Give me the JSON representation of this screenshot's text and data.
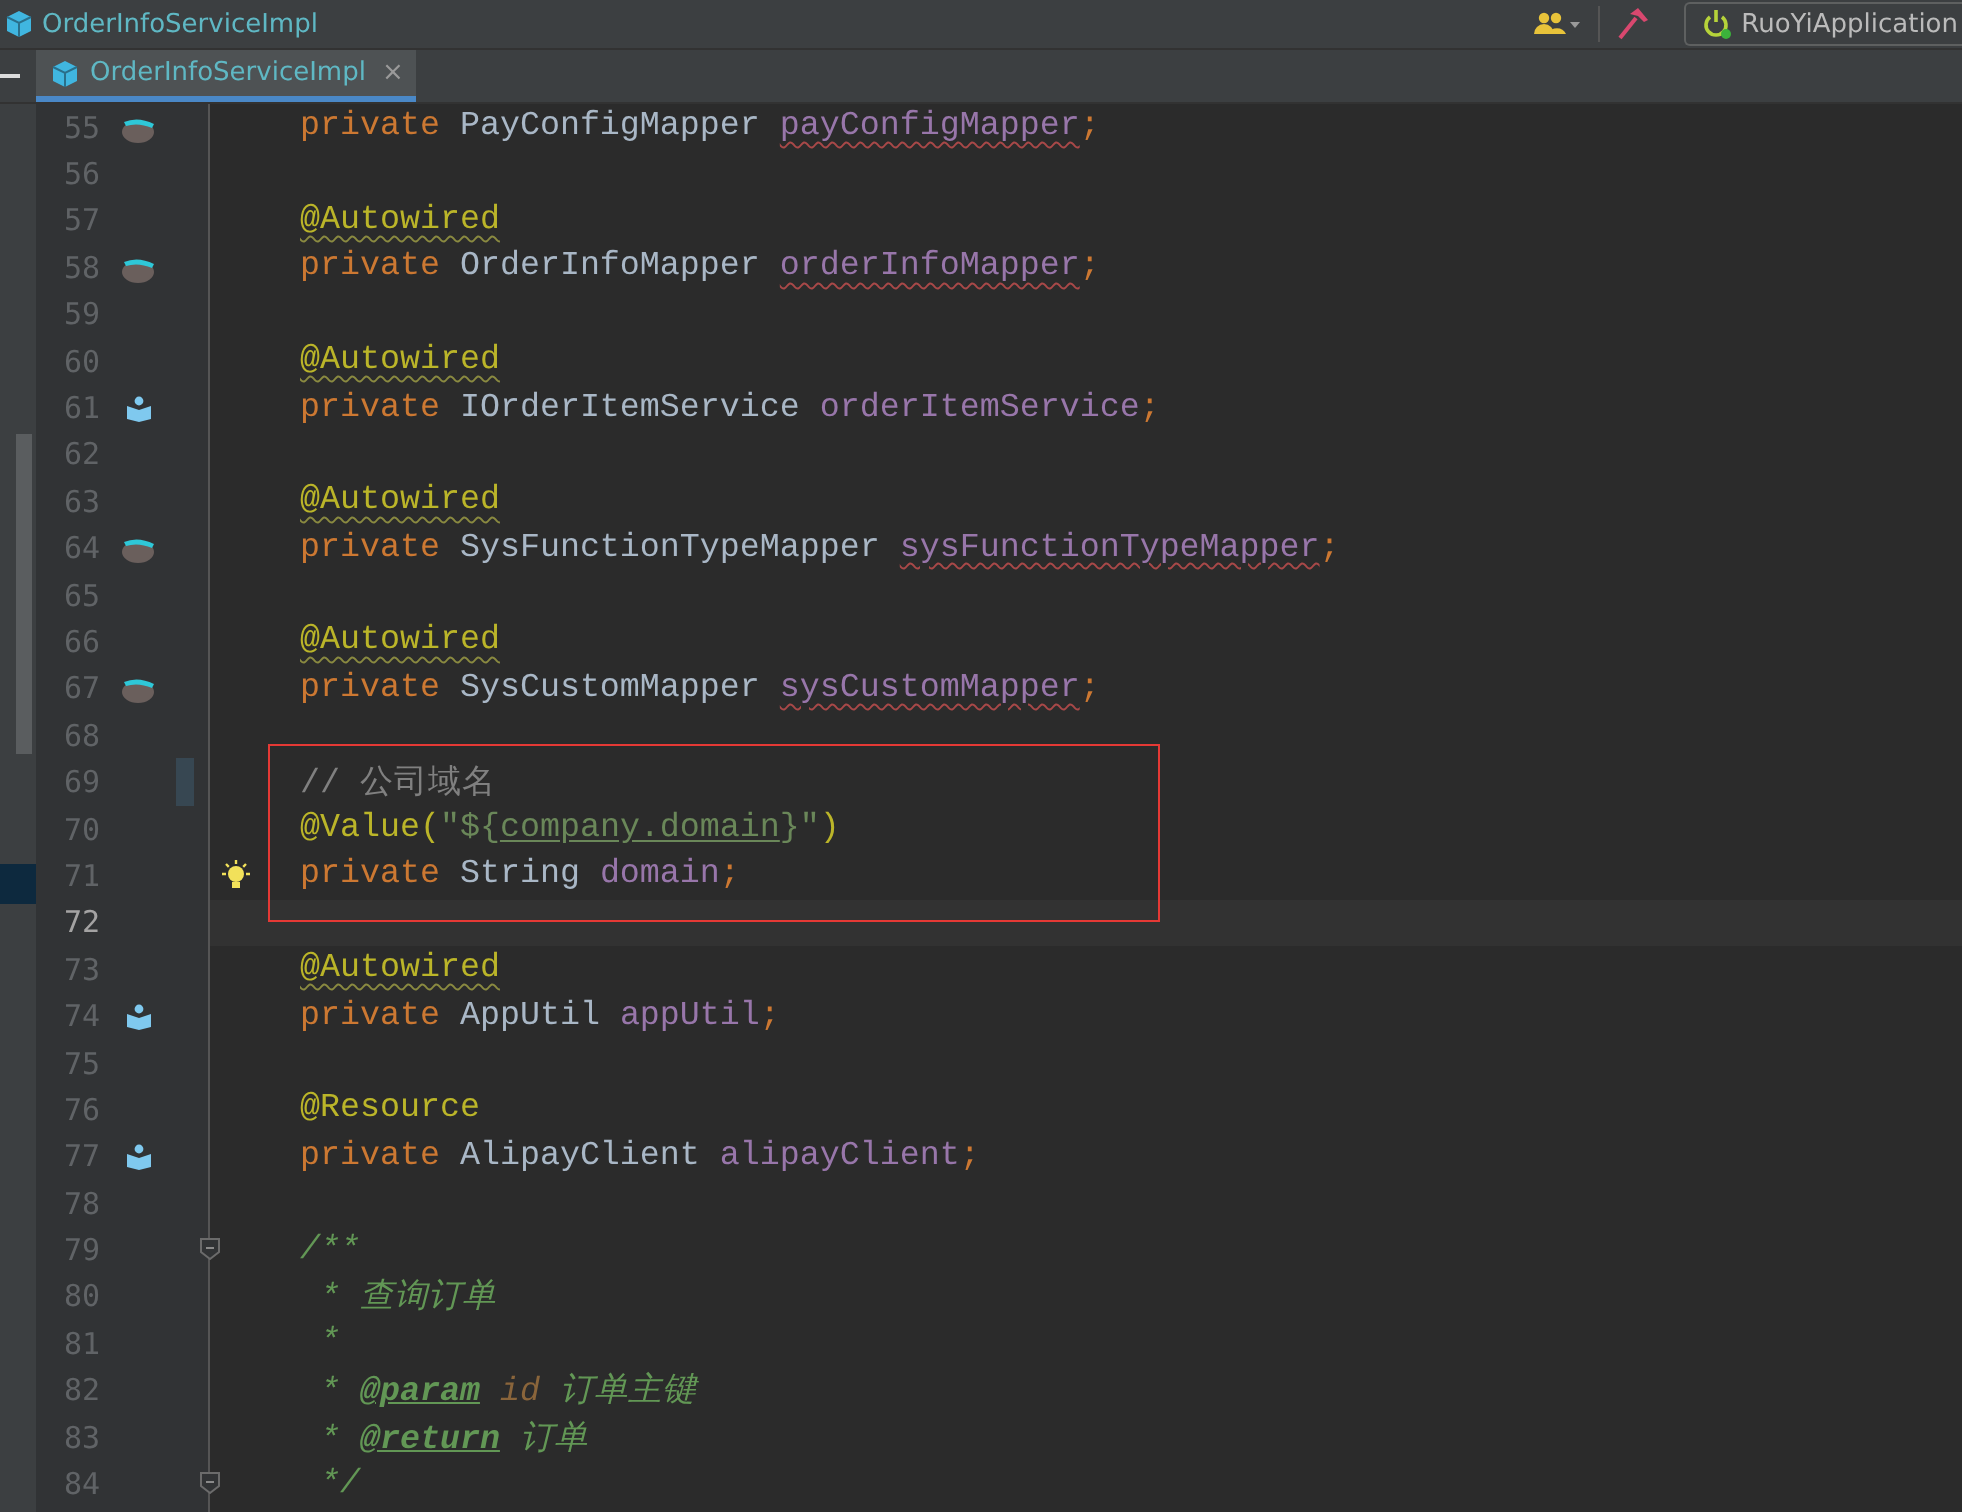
{
  "title_bar": {
    "file_name": "OrderInfoServiceImpl",
    "run_config": "RuoYiApplication"
  },
  "tabs": [
    {
      "label": "OrderInfoServiceImpl",
      "selected": true,
      "close": "×"
    }
  ],
  "editor": {
    "lines": [
      {
        "number": "55",
        "gutter_icon": {
          "kind": "bean"
        },
        "tokens": [
          {
            "text": "private ",
            "kind": "keyword"
          },
          {
            "text": "PayConfigMapper ",
            "kind": "type"
          },
          {
            "text": "payConfigMapper",
            "kind": "field",
            "typo": true
          },
          {
            "text": ";",
            "kind": "keyword"
          }
        ]
      },
      {
        "number": "56"
      },
      {
        "number": "57",
        "tokens": [
          {
            "text": "@Autowired",
            "kind": "annotation",
            "warning": true
          }
        ]
      },
      {
        "number": "58",
        "gutter_icon": {
          "kind": "bean"
        },
        "tokens": [
          {
            "text": "private ",
            "kind": "keyword"
          },
          {
            "text": "OrderInfoMapper ",
            "kind": "type"
          },
          {
            "text": "orderInfoMapper",
            "kind": "field",
            "typo": true
          },
          {
            "text": ";",
            "kind": "keyword"
          }
        ]
      },
      {
        "number": "59"
      },
      {
        "number": "60",
        "tokens": [
          {
            "text": "@Autowired",
            "kind": "annotation",
            "warning": true
          }
        ]
      },
      {
        "number": "61",
        "gutter_icon": {
          "kind": "implement"
        },
        "tokens": [
          {
            "text": "private ",
            "kind": "keyword"
          },
          {
            "text": "IOrderItemService ",
            "kind": "type"
          },
          {
            "text": "orderItemService",
            "kind": "field"
          },
          {
            "text": ";",
            "kind": "keyword"
          }
        ]
      },
      {
        "number": "62"
      },
      {
        "number": "63",
        "tokens": [
          {
            "text": "@Autowired",
            "kind": "annotation",
            "warning": true
          }
        ]
      },
      {
        "number": "64",
        "gutter_icon": {
          "kind": "bean"
        },
        "tokens": [
          {
            "text": "private ",
            "kind": "keyword"
          },
          {
            "text": "SysFunctionTypeMapper ",
            "kind": "type"
          },
          {
            "text": "sysFunctionTypeMapper",
            "kind": "field",
            "typo": true
          },
          {
            "text": ";",
            "kind": "keyword"
          }
        ]
      },
      {
        "number": "65"
      },
      {
        "number": "66",
        "tokens": [
          {
            "text": "@Autowired",
            "kind": "annotation",
            "warning": true
          }
        ]
      },
      {
        "number": "67",
        "gutter_icon": {
          "kind": "bean"
        },
        "tokens": [
          {
            "text": "private ",
            "kind": "keyword"
          },
          {
            "text": "SysCustomMapper ",
            "kind": "type"
          },
          {
            "text": "sysCustomMapper",
            "kind": "field",
            "typo": true
          },
          {
            "text": ";",
            "kind": "keyword"
          }
        ]
      },
      {
        "number": "68"
      },
      {
        "number": "69",
        "changed": true,
        "boxed": true,
        "tokens": [
          {
            "text": "// 公司域名",
            "kind": "comment"
          }
        ]
      },
      {
        "number": "70",
        "boxed": true,
        "tokens": [
          {
            "text": "@Value(",
            "kind": "annotation"
          },
          {
            "text": "\"${",
            "kind": "string"
          },
          {
            "text": "company.domain",
            "kind": "string",
            "linked": true
          },
          {
            "text": "}\"",
            "kind": "string"
          },
          {
            "text": ")",
            "kind": "annotation"
          }
        ]
      },
      {
        "number": "71",
        "gutter_icon": {
          "kind": "bulb"
        },
        "boxed": true,
        "tokens": [
          {
            "text": "private ",
            "kind": "keyword"
          },
          {
            "text": "String ",
            "kind": "type"
          },
          {
            "text": "domain",
            "kind": "field"
          },
          {
            "text": ";",
            "kind": "keyword"
          }
        ]
      },
      {
        "number": "72",
        "current": true,
        "boxed": true
      },
      {
        "number": "73",
        "tokens": [
          {
            "text": "@Autowired",
            "kind": "annotation",
            "warning": true
          }
        ]
      },
      {
        "number": "74",
        "gutter_icon": {
          "kind": "implement"
        },
        "tokens": [
          {
            "text": "private ",
            "kind": "keyword"
          },
          {
            "text": "AppUtil ",
            "kind": "type"
          },
          {
            "text": "appUtil",
            "kind": "field"
          },
          {
            "text": ";",
            "kind": "keyword"
          }
        ]
      },
      {
        "number": "75"
      },
      {
        "number": "76",
        "tokens": [
          {
            "text": "@Resource",
            "kind": "annotation"
          }
        ]
      },
      {
        "number": "77",
        "gutter_icon": {
          "kind": "implement"
        },
        "tokens": [
          {
            "text": "private ",
            "kind": "keyword"
          },
          {
            "text": "AlipayClient ",
            "kind": "type"
          },
          {
            "text": "alipayClient",
            "kind": "field"
          },
          {
            "text": ";",
            "kind": "keyword"
          }
        ]
      },
      {
        "number": "78"
      },
      {
        "number": "79",
        "gutter_icon": {
          "kind": "fold"
        },
        "tokens": [
          {
            "text": "/**",
            "kind": "doc"
          }
        ]
      },
      {
        "number": "80",
        "tokens": [
          {
            "text": " * 查询订单",
            "kind": "doc"
          }
        ]
      },
      {
        "number": "81",
        "tokens": [
          {
            "text": " *",
            "kind": "doc"
          }
        ]
      },
      {
        "number": "82",
        "tokens": [
          {
            "text": " * ",
            "kind": "doc"
          },
          {
            "text": "@param",
            "kind": "doctag"
          },
          {
            "text": " id",
            "kind": "docparam"
          },
          {
            "text": " 订单主键",
            "kind": "doc"
          }
        ]
      },
      {
        "number": "83",
        "tokens": [
          {
            "text": " * ",
            "kind": "doc"
          },
          {
            "text": "@return",
            "kind": "doctag"
          },
          {
            "text": " 订单",
            "kind": "doc"
          }
        ]
      },
      {
        "number": "84",
        "gutter_icon": {
          "kind": "fold"
        },
        "tokens": [
          {
            "text": " */",
            "kind": "doc"
          }
        ]
      }
    ]
  }
}
